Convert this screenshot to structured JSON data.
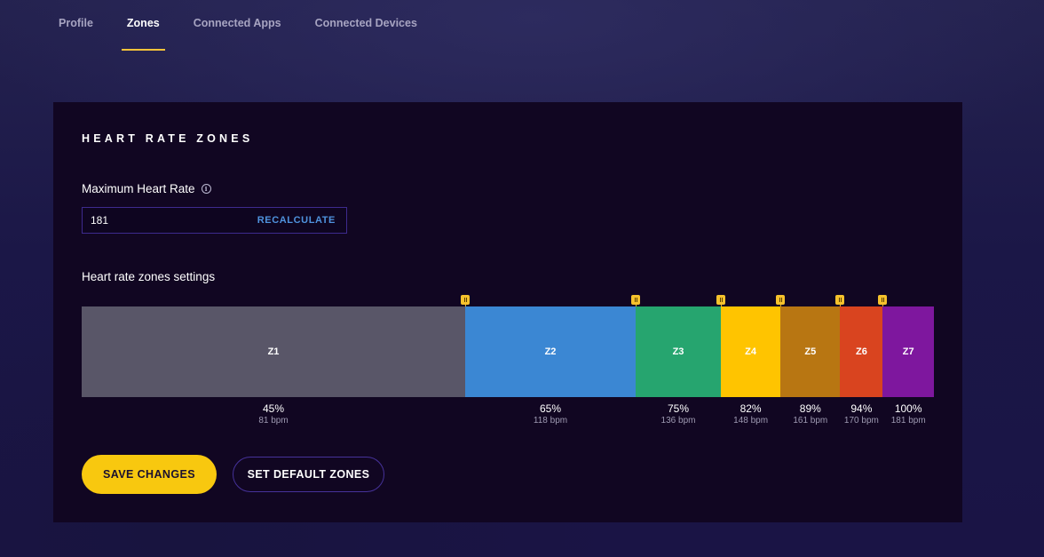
{
  "tabs": [
    {
      "label": "Profile",
      "active": false
    },
    {
      "label": "Zones",
      "active": true
    },
    {
      "label": "Connected Apps",
      "active": false
    },
    {
      "label": "Connected Devices",
      "active": false
    }
  ],
  "panel": {
    "title": "HEART RATE ZONES",
    "max_hr": {
      "label": "Maximum Heart Rate",
      "info_icon": "info-icon",
      "value": "181",
      "recalculate_label": "RECALCULATE"
    },
    "zones_settings_label": "Heart rate zones settings",
    "zones": [
      {
        "label": "Z1",
        "upper_pct": 45,
        "color": "#595668",
        "pct_label": "45%",
        "bpm_label": "81 bpm"
      },
      {
        "label": "Z2",
        "upper_pct": 65,
        "color": "#3b87d3",
        "pct_label": "65%",
        "bpm_label": "118 bpm"
      },
      {
        "label": "Z3",
        "upper_pct": 75,
        "color": "#26a56f",
        "pct_label": "75%",
        "bpm_label": "136 bpm"
      },
      {
        "label": "Z4",
        "upper_pct": 82,
        "color": "#ffc400",
        "pct_label": "82%",
        "bpm_label": "148 bpm"
      },
      {
        "label": "Z5",
        "upper_pct": 89,
        "color": "#b87612",
        "pct_label": "89%",
        "bpm_label": "161 bpm"
      },
      {
        "label": "Z6",
        "upper_pct": 94,
        "color": "#d9441f",
        "pct_label": "94%",
        "bpm_label": "170 bpm"
      },
      {
        "label": "Z7",
        "upper_pct": 100,
        "color": "#7e179e",
        "pct_label": "100%",
        "bpm_label": "181 bpm"
      }
    ],
    "buttons": {
      "save_label": "SAVE CHANGES",
      "default_label": "SET DEFAULT ZONES"
    }
  },
  "colors": {
    "accent": "#f8c80f",
    "link": "#4f93de",
    "panel_bg": "#110622"
  }
}
